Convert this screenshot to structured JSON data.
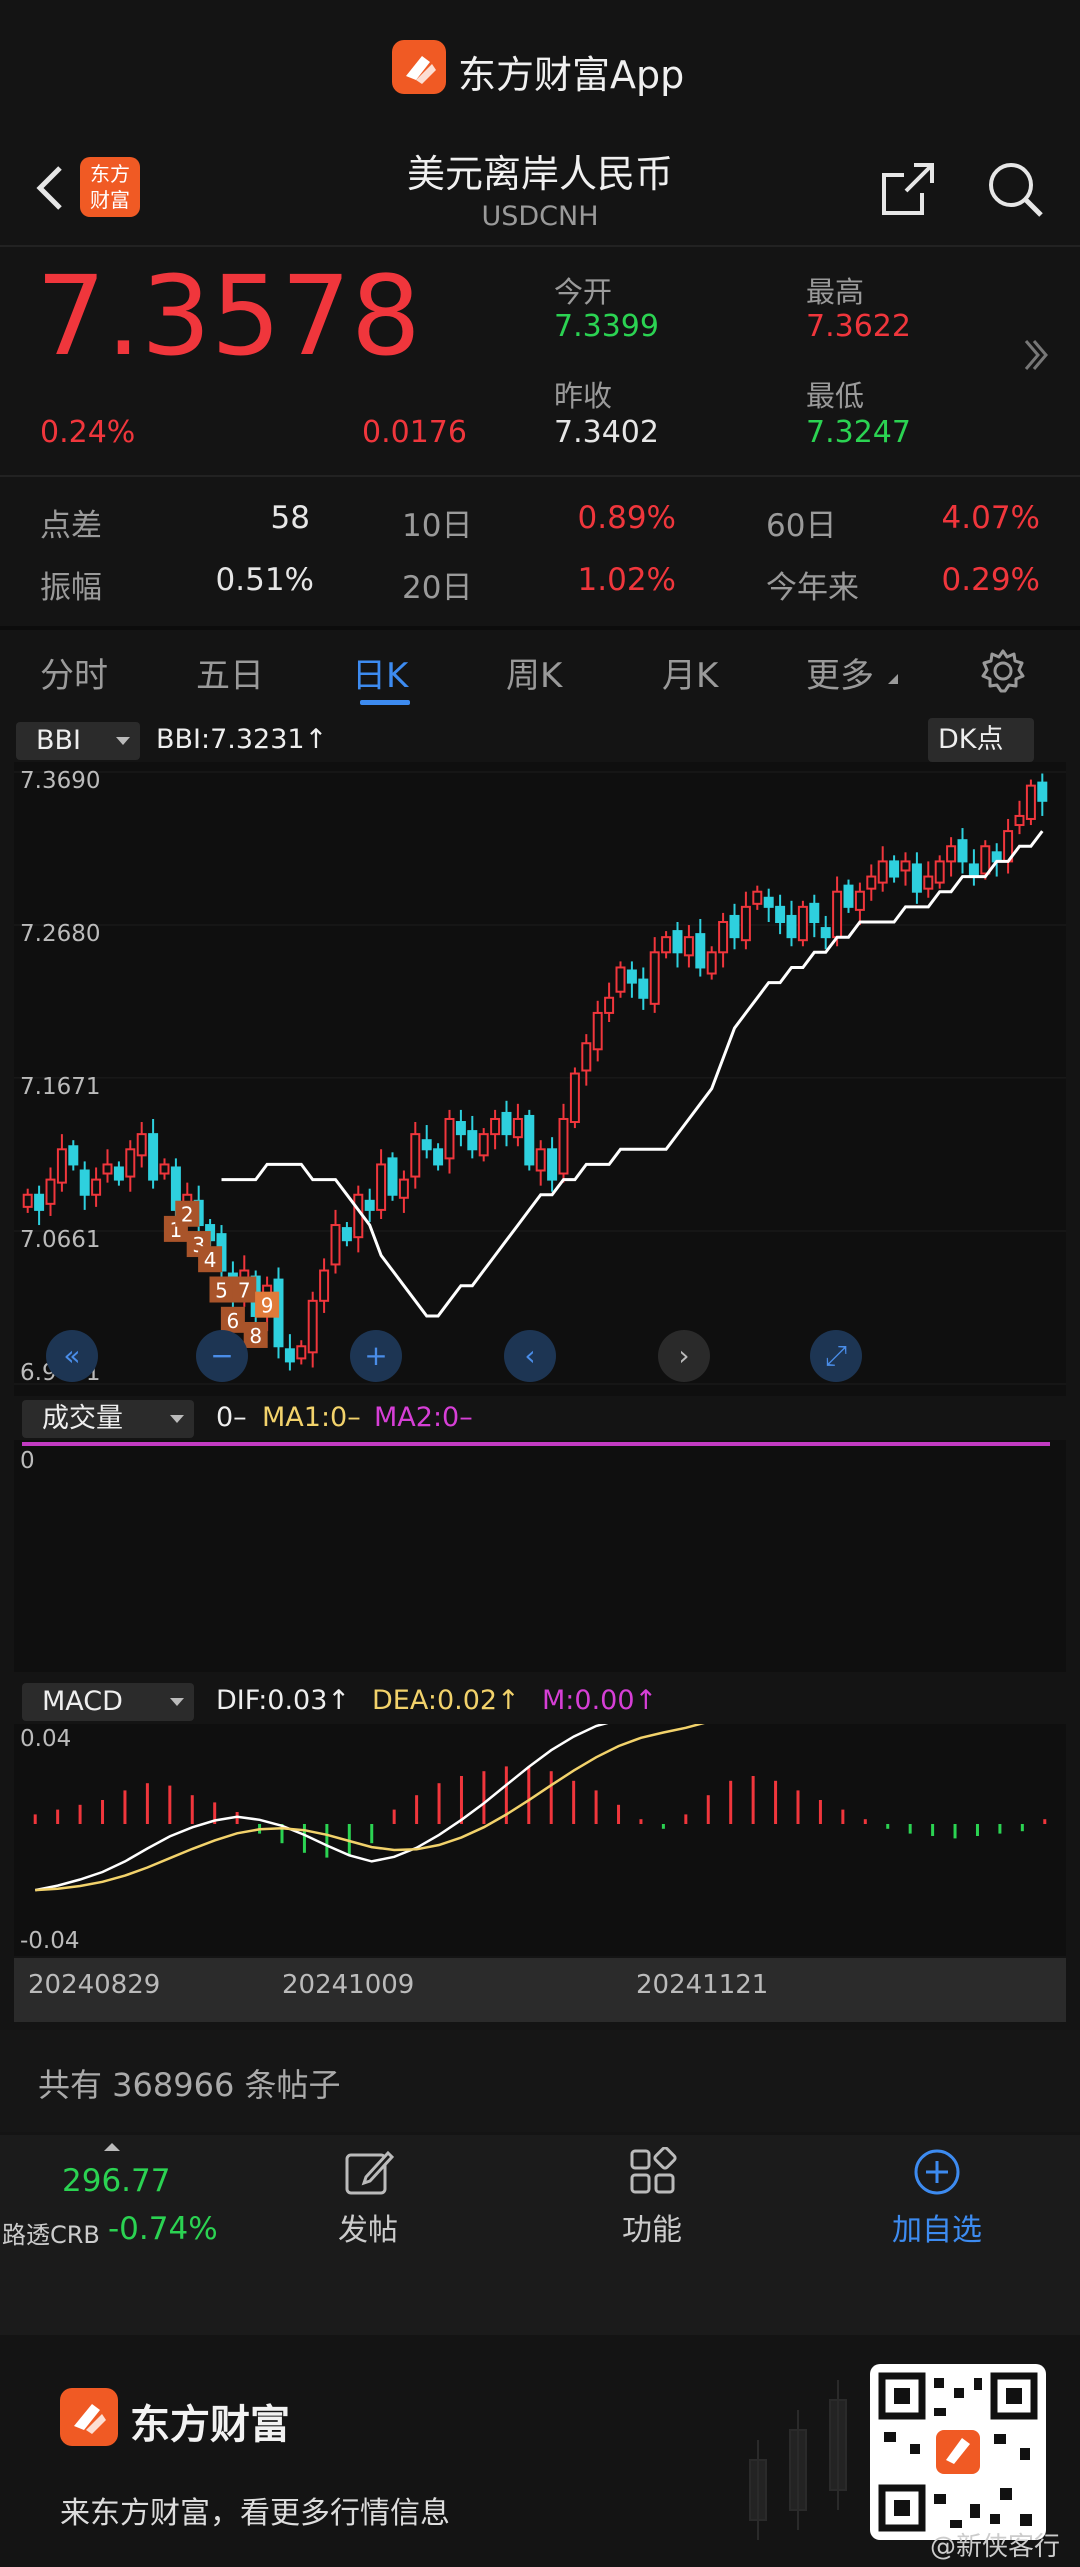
{
  "app_title": "东方财富App",
  "header": {
    "title": "美元离岸人民币",
    "subtitle": "USDCNH",
    "logo_text": "东方财富"
  },
  "quote": {
    "price": "7.3578",
    "change_pct": "0.24%",
    "change": "0.0176",
    "open_label": "今开",
    "open": "7.3399",
    "high_label": "最高",
    "high": "7.3622",
    "prev_close_label": "昨收",
    "prev_close": "7.3402",
    "low_label": "最低",
    "low": "7.3247"
  },
  "stats": [
    {
      "label": "点差",
      "value": "58"
    },
    {
      "label": "10日",
      "value": "0.89%"
    },
    {
      "label": "60日",
      "value": "4.07%"
    },
    {
      "label": "振幅",
      "value": "0.51%"
    },
    {
      "label": "20日",
      "value": "1.02%"
    },
    {
      "label": "今年来",
      "value": "0.29%"
    }
  ],
  "tabs": [
    "分时",
    "五日",
    "日K",
    "周K",
    "月K",
    "更多"
  ],
  "chart_data": {
    "type": "candlestick",
    "indicator": "BBI",
    "indicator_value": "BBI:7.3231↑",
    "dk_label": "DK点",
    "y_ticks": [
      "7.3690",
      "7.2680",
      "7.1671",
      "7.0661",
      "6.9651"
    ],
    "ylim": [
      6.9651,
      7.369
    ],
    "x_ticks": [
      "20240829",
      "20241009",
      "20241121"
    ],
    "close": [
      7.09,
      7.08,
      7.1,
      7.12,
      7.11,
      7.09,
      7.1,
      7.11,
      7.1,
      7.12,
      7.13,
      7.1,
      7.11,
      7.08,
      7.09,
      7.07,
      7.06,
      7.04,
      7.02,
      7.04,
      7.01,
      7.03,
      6.99,
      6.98,
      6.99,
      7.02,
      7.04,
      7.07,
      7.06,
      7.09,
      7.08,
      7.11,
      7.09,
      7.1,
      7.13,
      7.12,
      7.11,
      7.14,
      7.13,
      7.12,
      7.13,
      7.14,
      7.13,
      7.14,
      7.11,
      7.12,
      7.1,
      7.14,
      7.17,
      7.19,
      7.21,
      7.22,
      7.24,
      7.23,
      7.22,
      7.25,
      7.26,
      7.25,
      7.26,
      7.24,
      7.25,
      7.27,
      7.26,
      7.28,
      7.29,
      7.28,
      7.27,
      7.26,
      7.28,
      7.27,
      7.26,
      7.29,
      7.28,
      7.29,
      7.3,
      7.31,
      7.3,
      7.31,
      7.29,
      7.3,
      7.31,
      7.32,
      7.31,
      7.3,
      7.32,
      7.31,
      7.33,
      7.34,
      7.36,
      7.35
    ],
    "bbi": [
      7.1,
      7.1,
      7.1,
      7.1,
      7.11,
      7.11,
      7.11,
      7.11,
      7.1,
      7.1,
      7.1,
      7.09,
      7.08,
      7.07,
      7.05,
      7.04,
      7.03,
      7.02,
      7.01,
      7.01,
      7.02,
      7.03,
      7.03,
      7.04,
      7.05,
      7.06,
      7.07,
      7.08,
      7.09,
      7.09,
      7.1,
      7.1,
      7.11,
      7.11,
      7.11,
      7.12,
      7.12,
      7.12,
      7.12,
      7.12,
      7.13,
      7.14,
      7.15,
      7.16,
      7.18,
      7.2,
      7.21,
      7.22,
      7.23,
      7.23,
      7.24,
      7.24,
      7.25,
      7.25,
      7.26,
      7.26,
      7.27,
      7.27,
      7.27,
      7.27,
      7.28,
      7.28,
      7.28,
      7.29,
      7.29,
      7.3,
      7.3,
      7.3,
      7.31,
      7.31,
      7.32,
      7.32,
      7.33
    ],
    "td_marks": [
      "1",
      "2",
      "3",
      "4",
      "5",
      "6",
      "7",
      "8",
      "9"
    ],
    "volume": {
      "label": "成交量",
      "legend": "0–",
      "ma1": "MA1:0–",
      "ma2": "MA2:0–",
      "axis": "0"
    },
    "macd": {
      "label": "MACD",
      "dif_label": "DIF:0.03↑",
      "dea_label": "DEA:0.02↑",
      "m_label": "M:0.00↑",
      "y_ticks": [
        "0.04",
        "-0.04"
      ],
      "hist": [
        0.004,
        0.006,
        0.008,
        0.01,
        0.014,
        0.017,
        0.016,
        0.012,
        0.009,
        0.005,
        -0.004,
        -0.008,
        -0.012,
        -0.014,
        -0.013,
        -0.008,
        0.006,
        0.012,
        0.017,
        0.02,
        0.022,
        0.024,
        0.024,
        0.022,
        0.018,
        0.014,
        0.008,
        0.002,
        -0.002,
        0.004,
        0.012,
        0.018,
        0.02,
        0.018,
        0.014,
        0.01,
        0.006,
        0.002,
        -0.002,
        -0.004,
        -0.005,
        -0.006,
        -0.005,
        -0.004,
        -0.003,
        0.002
      ]
    }
  },
  "volume_scale": "0",
  "posts": "共有 368966 条帖子",
  "bottom_bar": {
    "crb_value": "296.77",
    "crb_label": "路透CRB",
    "crb_change": "-0.74%",
    "post": "发帖",
    "features": "功能",
    "add": "加自选"
  },
  "promo": {
    "brand": "东方财富",
    "slogan": "来东方财富，看更多行情信息",
    "watermark": "@新侠客行"
  },
  "colors": {
    "up": "#f0363c",
    "down": "#2bd352",
    "accent": "#3d8bf0",
    "bbi": "#ffffff"
  }
}
